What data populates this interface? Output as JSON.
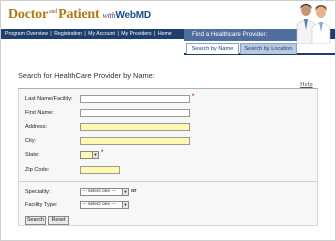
{
  "header": {
    "logo_part1": "Doctor",
    "logo_and": "and",
    "logo_part2": "Patient",
    "logo_with": "with",
    "logo_brand": "WebMD"
  },
  "nav": {
    "items": [
      "Program Overview",
      "Registration",
      "My Account",
      "My Providers",
      "Home"
    ],
    "separator": "|"
  },
  "find_banner": "Find a Healthcare Provider:",
  "tabs": [
    {
      "label": "Search by Name"
    },
    {
      "label": "Search by Location"
    }
  ],
  "page_title": "Search for HealthCare Provider by Name:",
  "help_link": "Help",
  "form": {
    "last_name_label": "Last Name/Facility:",
    "first_name_label": "First Name:",
    "address_label": "Address:",
    "city_label": "City:",
    "state_label": "State:",
    "zip_label": "Zip Code:",
    "speciality_label": "Speciality:",
    "facility_type_label": "Facility Type:",
    "speciality_value": "--- select one ---",
    "facility_type_value": "--- select one ---",
    "or_text": "or",
    "required_mark": "*"
  },
  "buttons": {
    "search": "Search",
    "reset": "Reset"
  },
  "colors": {
    "nav_bg": "#1e3f6e",
    "required": "#c0392b",
    "highlight_field": "#fdfab0"
  }
}
